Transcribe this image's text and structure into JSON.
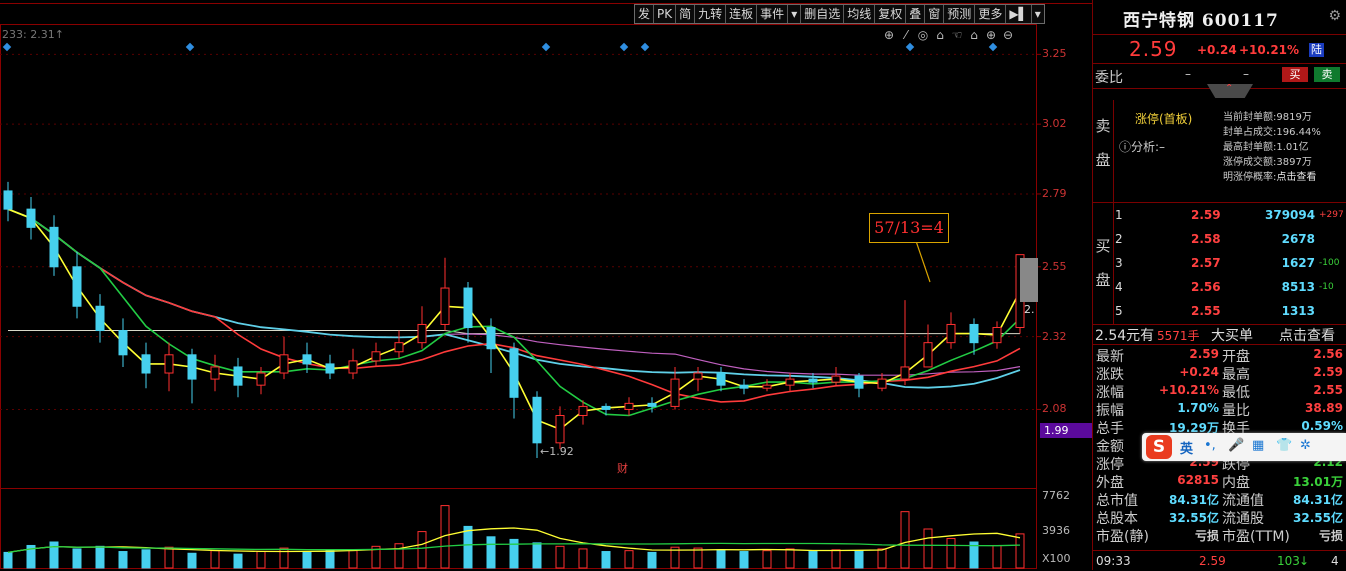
{
  "toolbar": [
    "发",
    "PK",
    "简",
    "九转",
    "连板",
    "事件",
    "▾",
    "删自选",
    "均线",
    "复权",
    "叠",
    "窗",
    "预测",
    "更多",
    "▶▌",
    "▾"
  ],
  "chart_icons": [
    "⊕",
    "⁄",
    "◎",
    "⌂",
    "☜",
    "⌂",
    "⊕",
    "⊖"
  ],
  "ma_label": "233: 2.31↑",
  "price_axis": {
    "labels": [
      "3.25",
      "3.02",
      "2.79",
      "2.55",
      "2.32",
      "2.08"
    ]
  },
  "price_tag": "1.99",
  "volume_axis": {
    "labels": [
      "7762",
      "3936",
      "X100"
    ]
  },
  "annotation": "57/13=4",
  "low_label": "←1.92",
  "cai_label": "财",
  "right_partial": "2.",
  "chart_data": {
    "type": "candlestick",
    "ylim": [
      1.92,
      3.35
    ],
    "y_ticks": [
      3.25,
      3.02,
      2.79,
      2.55,
      2.32,
      2.08
    ],
    "candles": [
      [
        2.8,
        2.74,
        2.83,
        2.7
      ],
      [
        2.74,
        2.68,
        2.78,
        2.64
      ],
      [
        2.68,
        2.55,
        2.72,
        2.52
      ],
      [
        2.55,
        2.42,
        2.6,
        2.38
      ],
      [
        2.42,
        2.34,
        2.46,
        2.3
      ],
      [
        2.34,
        2.26,
        2.38,
        2.22
      ],
      [
        2.26,
        2.2,
        2.3,
        2.15
      ],
      [
        2.2,
        2.26,
        2.3,
        2.14
      ],
      [
        2.26,
        2.18,
        2.28,
        2.1
      ],
      [
        2.18,
        2.22,
        2.26,
        2.14
      ],
      [
        2.22,
        2.16,
        2.25,
        2.12
      ],
      [
        2.16,
        2.2,
        2.22,
        2.13
      ],
      [
        2.2,
        2.26,
        2.32,
        2.18
      ],
      [
        2.26,
        2.23,
        2.3,
        2.2
      ],
      [
        2.23,
        2.2,
        2.26,
        2.18
      ],
      [
        2.2,
        2.24,
        2.28,
        2.18
      ],
      [
        2.24,
        2.27,
        2.3,
        2.22
      ],
      [
        2.27,
        2.3,
        2.34,
        2.25
      ],
      [
        2.3,
        2.36,
        2.42,
        2.28
      ],
      [
        2.36,
        2.48,
        2.58,
        2.34
      ],
      [
        2.48,
        2.35,
        2.5,
        2.3
      ],
      [
        2.35,
        2.28,
        2.38,
        2.2
      ],
      [
        2.28,
        2.12,
        2.3,
        2.05
      ],
      [
        2.12,
        1.97,
        2.14,
        1.92
      ],
      [
        1.97,
        2.06,
        2.09,
        1.95
      ],
      [
        2.06,
        2.09,
        2.11,
        2.03
      ],
      [
        2.09,
        2.08,
        2.1,
        2.06
      ],
      [
        2.08,
        2.1,
        2.12,
        2.06
      ],
      [
        2.1,
        2.09,
        2.12,
        2.07
      ],
      [
        2.09,
        2.18,
        2.22,
        2.08
      ],
      [
        2.18,
        2.2,
        2.22,
        2.14
      ],
      [
        2.2,
        2.16,
        2.22,
        2.14
      ],
      [
        2.16,
        2.15,
        2.18,
        2.13
      ],
      [
        2.15,
        2.16,
        2.18,
        2.14
      ],
      [
        2.16,
        2.18,
        2.2,
        2.14
      ],
      [
        2.18,
        2.17,
        2.2,
        2.15
      ],
      [
        2.17,
        2.19,
        2.22,
        2.16
      ],
      [
        2.19,
        2.15,
        2.2,
        2.12
      ],
      [
        2.15,
        2.18,
        2.2,
        2.14
      ],
      [
        2.18,
        2.22,
        2.44,
        2.16
      ],
      [
        2.22,
        2.3,
        2.36,
        2.22
      ],
      [
        2.3,
        2.36,
        2.4,
        2.28
      ],
      [
        2.36,
        2.3,
        2.38,
        2.26
      ],
      [
        2.3,
        2.35,
        2.37,
        2.28
      ],
      [
        2.35,
        2.59,
        2.59,
        2.33
      ]
    ],
    "volume": {
      "ylim": [
        0,
        9000
      ],
      "values": [
        1800,
        2600,
        3000,
        2200,
        2500,
        1900,
        2100,
        2400,
        1700,
        2000,
        1600,
        1900,
        2300,
        1800,
        2100,
        2000,
        2500,
        2800,
        4200,
        7200,
        4800,
        3600,
        3300,
        2900,
        2500,
        2200,
        1900,
        2000,
        1800,
        2400,
        2300,
        2100,
        1900,
        2000,
        2200,
        1900,
        2100,
        2000,
        2200,
        6500,
        4500,
        3400,
        3000,
        2600,
        3936
      ]
    }
  },
  "panel": {
    "stock_name": "西宁特钢 600117",
    "price": "2.59",
    "change": "+0.24",
    "change_pct": "+10.21%",
    "lu": "陆",
    "weibi_label": "委比",
    "weibi_d1": "–",
    "weibi_d2": "–",
    "buy_btn": "买",
    "sell_btn": "卖",
    "sell_vert": [
      "卖",
      "盘"
    ],
    "buy_vert": [
      "买",
      "盘"
    ],
    "zt_title": "涨停(首板)",
    "fenxi": "ⓘ分析:–",
    "zt_info": [
      {
        "k": "当前封单额:",
        "v": "9819万"
      },
      {
        "k": "封单占成交:",
        "v": "196.44%"
      },
      {
        "k": "最高封单额:",
        "v": "1.01亿"
      },
      {
        "k": "涨停成交额:",
        "v": "3897万"
      },
      {
        "k": "明涨停概率:",
        "v": "点击查看"
      }
    ],
    "buy_rows": [
      {
        "i": "1",
        "p": "2.59",
        "q": "379094",
        "c": "+297",
        "cc": "#ff4040"
      },
      {
        "i": "2",
        "p": "2.58",
        "q": "2678",
        "c": "",
        "cc": "#ff4040"
      },
      {
        "i": "3",
        "p": "2.57",
        "q": "1627",
        "c": "-100",
        "cc": "#3ad13a"
      },
      {
        "i": "4",
        "p": "2.56",
        "q": "8513",
        "c": "-10",
        "cc": "#3ad13a"
      },
      {
        "i": "5",
        "p": "2.55",
        "q": "1313",
        "c": "",
        "cc": "#ff4040"
      }
    ],
    "big_row": {
      "a": "2.54元有",
      "b": "5571手",
      "c": "大买单",
      "d": "点击查看"
    },
    "stats": [
      {
        "l1": "最新",
        "v1": "2.59",
        "c1": "#ff4040",
        "l2": "开盘",
        "v2": "2.56",
        "c2": "#ff4040"
      },
      {
        "l1": "涨跌",
        "v1": "+0.24",
        "c1": "#ff4040",
        "l2": "最高",
        "v2": "2.59",
        "c2": "#ff4040"
      },
      {
        "l1": "涨幅",
        "v1": "+10.21%",
        "c1": "#ff4040",
        "l2": "最低",
        "v2": "2.55",
        "c2": "#ff4040"
      },
      {
        "l1": "振幅",
        "v1": "1.70%",
        "c1": "#5fdcff",
        "l2": "量比",
        "v2": "38.89",
        "c2": "#ff4040"
      },
      {
        "l1": "总手",
        "v1": "19.29万",
        "c1": "#5fdcff",
        "l2": "换手",
        "v2": "0.59%",
        "c2": "#5fdcff"
      },
      {
        "l1": "金额",
        "v1": "",
        "c1": "#5fdcff",
        "l2": "",
        "v2": "",
        "c2": "#5fdcff"
      },
      {
        "l1": "涨停",
        "v1": "2.59",
        "c1": "#ff4040",
        "l2": "跌停",
        "v2": "2.12",
        "c2": "#3ad13a"
      },
      {
        "l1": "外盘",
        "v1": "62815",
        "c1": "#ff4040",
        "l2": "内盘",
        "v2": "13.01万",
        "c2": "#3ad13a"
      },
      {
        "l1": "总市值",
        "v1": "84.31亿",
        "c1": "#5fdcff",
        "l2": "流通值",
        "v2": "84.31亿",
        "c2": "#5fdcff"
      },
      {
        "l1": "总股本",
        "v1": "32.55亿",
        "c1": "#5fdcff",
        "l2": "流通股",
        "v2": "32.55亿",
        "c2": "#5fdcff"
      },
      {
        "l1": "市盈(静)",
        "v1": "亏损",
        "c1": "#ccc",
        "l2": "市盈(TTM)",
        "v2": "亏损",
        "c2": "#ccc"
      }
    ],
    "bottom": {
      "time": "09:33",
      "price": "2.59",
      "vol": "103",
      "arrow": "↓",
      "n": "4"
    },
    "ime": {
      "logo": "S",
      "ying": "英",
      "icons": [
        "•,",
        "🎤",
        "▦",
        "👕",
        "✲"
      ]
    }
  }
}
